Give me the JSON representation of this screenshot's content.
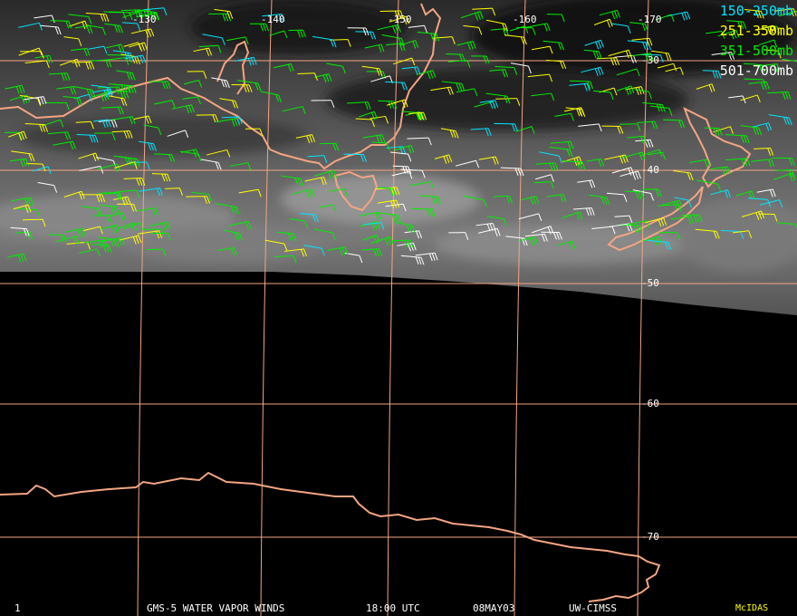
{
  "map": {
    "longitude_labels": [
      "-130",
      "-140",
      "-150",
      "-160",
      "-170"
    ],
    "latitude_labels": [
      "-30",
      "-40",
      "-50",
      "-60",
      "-70"
    ],
    "coastline_color": "#f4a582",
    "grid_color": "#f4a582"
  },
  "legend": [
    {
      "label": "150-250mb",
      "color": "#00e5ff"
    },
    {
      "label": "251-350mb",
      "color": "#ffff00"
    },
    {
      "label": "351-500mb",
      "color": "#00ee00"
    },
    {
      "label": "501-700mb",
      "color": "#ffffff"
    }
  ],
  "footer": {
    "frame": "1",
    "product": "GMS-5 WATER VAPOR WINDS",
    "time": "18:00 UTC",
    "date": "08MAY03",
    "source": "UW-CIMSS",
    "software": "McIDAS",
    "software_color": "#ffff00"
  }
}
